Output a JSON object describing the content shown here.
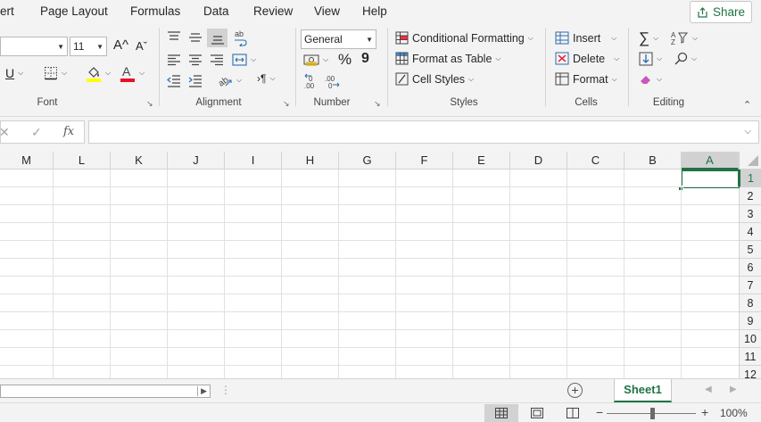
{
  "menu": {
    "tabs": [
      "ert",
      "Page Layout",
      "Formulas",
      "Data",
      "Review",
      "View",
      "Help"
    ],
    "share_label": "Share"
  },
  "ribbon": {
    "font": {
      "font_name": "",
      "font_size": "11",
      "grow_label": "A^",
      "shrink_label": "Aˇ",
      "underline_label": "U",
      "font_color": "#e81123",
      "highlight_color": "#ffff00",
      "group_label": "Font"
    },
    "alignment": {
      "group_label": "Alignment"
    },
    "number": {
      "format": "General",
      "percent_label": "%",
      "comma_label": "9",
      "group_label": "Number"
    },
    "styles": {
      "conditional_formatting": "Conditional Formatting",
      "format_as_table": "Format as Table",
      "cell_styles": "Cell Styles",
      "group_label": "Styles"
    },
    "cells": {
      "insert": "Insert",
      "delete": "Delete",
      "format": "Format",
      "group_label": "Cells"
    },
    "editing": {
      "group_label": "Editing"
    }
  },
  "formula_bar": {
    "fx_label": "fx",
    "value": ""
  },
  "grid": {
    "columns": [
      "M",
      "L",
      "K",
      "J",
      "I",
      "H",
      "G",
      "F",
      "E",
      "D",
      "C",
      "B",
      "A"
    ],
    "rows": [
      "1",
      "2",
      "3",
      "4",
      "5",
      "6",
      "7",
      "8",
      "9",
      "10",
      "11",
      "12"
    ],
    "selected_column": "A",
    "selected_row": "1"
  },
  "sheets": {
    "tabs": [
      "Sheet1"
    ],
    "active": "Sheet1"
  },
  "status": {
    "zoom": "100%",
    "zoom_minus": "−",
    "zoom_plus": "+"
  },
  "colors": {
    "accent": "#217346"
  }
}
